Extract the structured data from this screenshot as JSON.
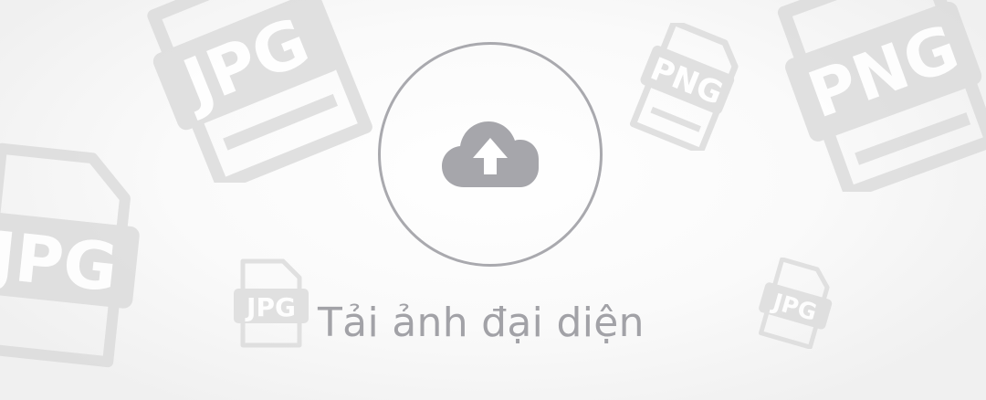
{
  "upload": {
    "label": "Tải ảnh đại diện",
    "icon": "cloud-upload-icon"
  },
  "background_icons": [
    {
      "name": "jpg-file-icon",
      "text": "JPG"
    },
    {
      "name": "png-file-icon",
      "text": "PNG"
    },
    {
      "name": "png-file-icon",
      "text": "PNG"
    },
    {
      "name": "jpg-file-icon",
      "text": "JPG"
    },
    {
      "name": "jpg-file-icon",
      "text": "JPG"
    },
    {
      "name": "jpg-file-icon",
      "text": "JPG"
    }
  ],
  "colors": {
    "icon_fill": "#dcdcdc",
    "circle_stroke": "#a9a9ae",
    "cloud_fill": "#a6a6ab",
    "label_color": "#a2a2a7"
  }
}
